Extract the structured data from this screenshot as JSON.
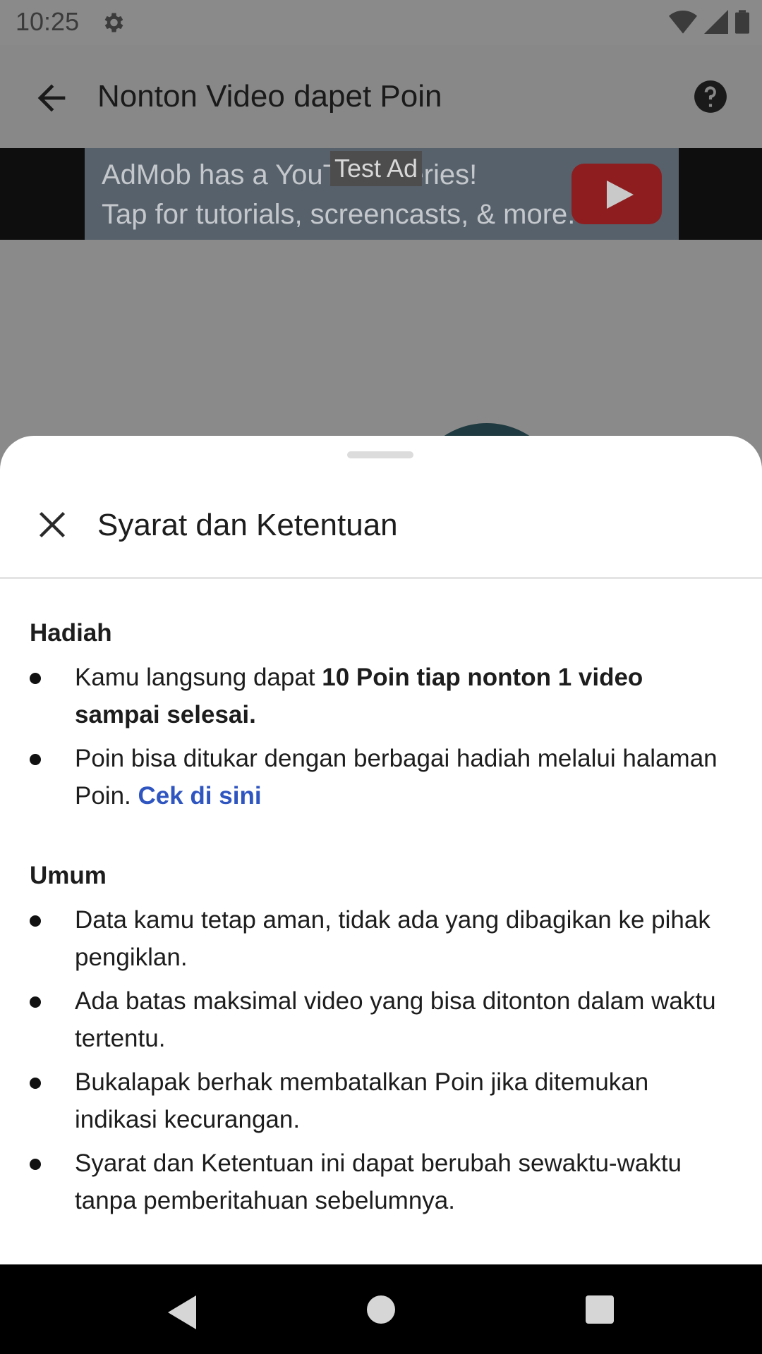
{
  "status": {
    "time": "10:25"
  },
  "appbar": {
    "title": "Nonton Video dapet Poin"
  },
  "ad": {
    "label": "Test Ad",
    "line1": "AdMob has a YouTube series!",
    "line2": "Tap for tutorials, screencasts, & more."
  },
  "sheet": {
    "title": "Syarat dan Ketentuan",
    "sections": [
      {
        "heading": "Hadiah",
        "items": [
          {
            "pre": "Kamu langsung dapat ",
            "bold": "10 Poin tiap nonton 1 video sampai selesai."
          },
          {
            "pre": "Poin bisa ditukar dengan berbagai hadiah melalui halaman Poin. ",
            "link": "Cek di sini"
          }
        ]
      },
      {
        "heading": "Umum",
        "items": [
          {
            "text": "Data kamu tetap aman, tidak ada yang dibagikan ke pihak pengiklan."
          },
          {
            "text": "Ada batas maksimal video yang bisa ditonton dalam waktu tertentu."
          },
          {
            "text": "Bukalapak berhak membatalkan Poin jika ditemukan indikasi kecurangan."
          },
          {
            "text": "Syarat dan Ketentuan ini dapat berubah sewaktu-waktu tanpa pemberitahuan sebelumnya."
          }
        ]
      }
    ]
  },
  "colors": {
    "link": "#2f55c0",
    "scrim": "#8a8a8a",
    "ad_bg": "#57616b"
  }
}
